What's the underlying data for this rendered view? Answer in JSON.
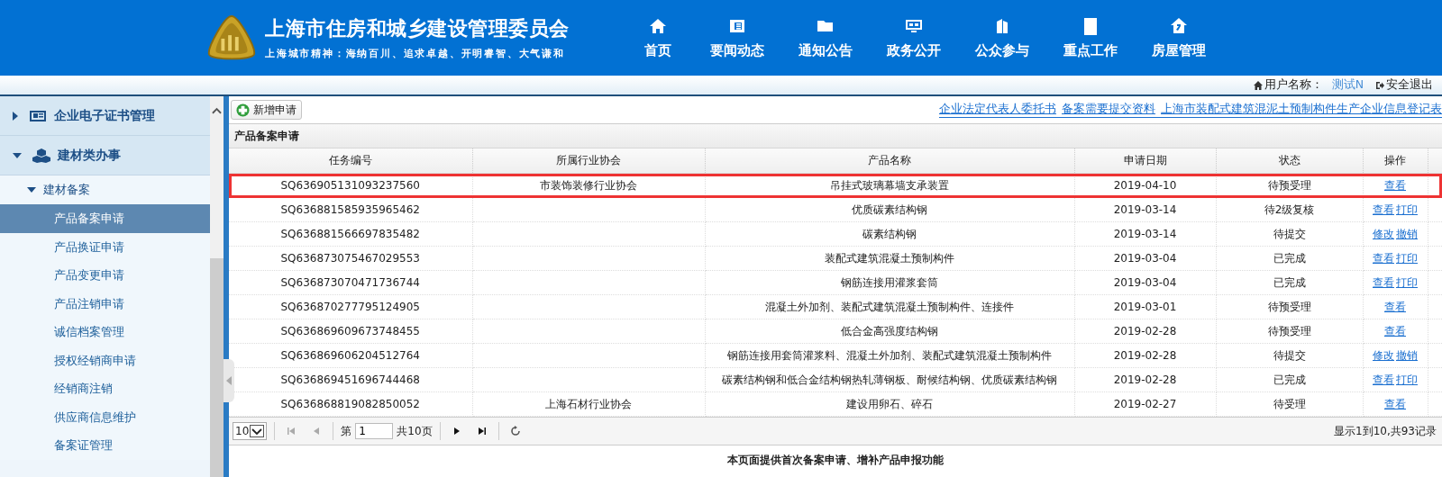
{
  "header": {
    "title": "上海市住房和城乡建设管理委员会",
    "slogan": "上海城市精神：海纳百川、追求卓越、开明睿智、大气谦和",
    "nav": [
      {
        "label": "首页"
      },
      {
        "label": "要闻动态"
      },
      {
        "label": "通知公告"
      },
      {
        "label": "政务公开"
      },
      {
        "label": "公众参与"
      },
      {
        "label": "重点工作"
      },
      {
        "label": "房屋管理"
      }
    ]
  },
  "user_bar": {
    "label": "用户名称：",
    "user": "测试N",
    "logout": "安全退出"
  },
  "sidebar": {
    "groups": [
      {
        "label": "企业电子证书管理",
        "expanded": false
      },
      {
        "label": "建材类办事",
        "expanded": true,
        "children": [
          {
            "label": "建材备案",
            "expanded": true,
            "children": [
              {
                "label": "产品备案申请",
                "selected": true
              },
              {
                "label": "产品换证申请",
                "selected": false
              },
              {
                "label": "产品变更申请",
                "selected": false
              },
              {
                "label": "产品注销申请",
                "selected": false
              },
              {
                "label": "诚信档案管理",
                "selected": false
              },
              {
                "label": "授权经销商申请",
                "selected": false
              },
              {
                "label": "经销商注销",
                "selected": false
              },
              {
                "label": "供应商信息维护",
                "selected": false
              },
              {
                "label": "备案证管理",
                "selected": false
              }
            ]
          }
        ]
      }
    ]
  },
  "toolbar": {
    "add_button": "新增申请",
    "links": [
      "企业法定代表人委托书",
      "备案需要提交资料",
      "上海市装配式建筑混泥土预制构件生产企业信息登记表"
    ]
  },
  "panel": {
    "title": "产品备案申请",
    "columns": [
      "任务编号",
      "所属行业协会",
      "产品名称",
      "申请日期",
      "状态",
      "操作"
    ],
    "rows": [
      {
        "task_no": "SQ636905131093237560",
        "association": "市装饰装修行业协会",
        "product": "吊挂式玻璃幕墙支承装置",
        "date": "2019-04-10",
        "status": "待预受理",
        "actions": [
          "查看"
        ],
        "selected": true
      },
      {
        "task_no": "SQ636881585935965462",
        "association": "",
        "product": "优质碳素结构钢",
        "date": "2019-03-14",
        "status": "待2级复核",
        "actions": [
          "查看",
          "打印"
        ],
        "selected": false
      },
      {
        "task_no": "SQ636881566697835482",
        "association": "",
        "product": "碳素结构钢",
        "date": "2019-03-14",
        "status": "待提交",
        "actions": [
          "修改",
          "撤销"
        ],
        "selected": false
      },
      {
        "task_no": "SQ636873075467029553",
        "association": "",
        "product": "装配式建筑混凝土预制构件",
        "date": "2019-03-04",
        "status": "已完成",
        "actions": [
          "查看",
          "打印"
        ],
        "selected": false
      },
      {
        "task_no": "SQ636873070471736744",
        "association": "",
        "product": "钢筋连接用灌浆套筒",
        "date": "2019-03-04",
        "status": "已完成",
        "actions": [
          "查看",
          "打印"
        ],
        "selected": false
      },
      {
        "task_no": "SQ636870277795124905",
        "association": "",
        "product": "混凝土外加剂、装配式建筑混凝土预制构件、连接件",
        "date": "2019-03-01",
        "status": "待预受理",
        "actions": [
          "查看"
        ],
        "selected": false
      },
      {
        "task_no": "SQ636869609673748455",
        "association": "",
        "product": "低合金高强度结构钢",
        "date": "2019-02-28",
        "status": "待预受理",
        "actions": [
          "查看"
        ],
        "selected": false
      },
      {
        "task_no": "SQ636869606204512764",
        "association": "",
        "product": "钢筋连接用套筒灌浆料、混凝土外加剂、装配式建筑混凝土预制构件",
        "date": "2019-02-28",
        "status": "待提交",
        "actions": [
          "修改",
          "撤销"
        ],
        "selected": false
      },
      {
        "task_no": "SQ636869451696744468",
        "association": "",
        "product": "碳素结构钢和低合金结构钢热轧薄钢板、耐候结构钢、优质碳素结构钢",
        "date": "2019-02-28",
        "status": "已完成",
        "actions": [
          "查看",
          "打印"
        ],
        "selected": false
      },
      {
        "task_no": "SQ636868819082850052",
        "association": "上海石材行业协会",
        "product": "建设用卵石、碎石",
        "date": "2019-02-27",
        "status": "待受理",
        "actions": [
          "查看"
        ],
        "selected": false
      }
    ],
    "pager": {
      "page_size": "10",
      "before": "第",
      "page": "1",
      "after": "共10页",
      "summary": "显示1到10,共93记录"
    }
  },
  "footer_note": "本页面提供首次备案申请、增补产品申报功能"
}
